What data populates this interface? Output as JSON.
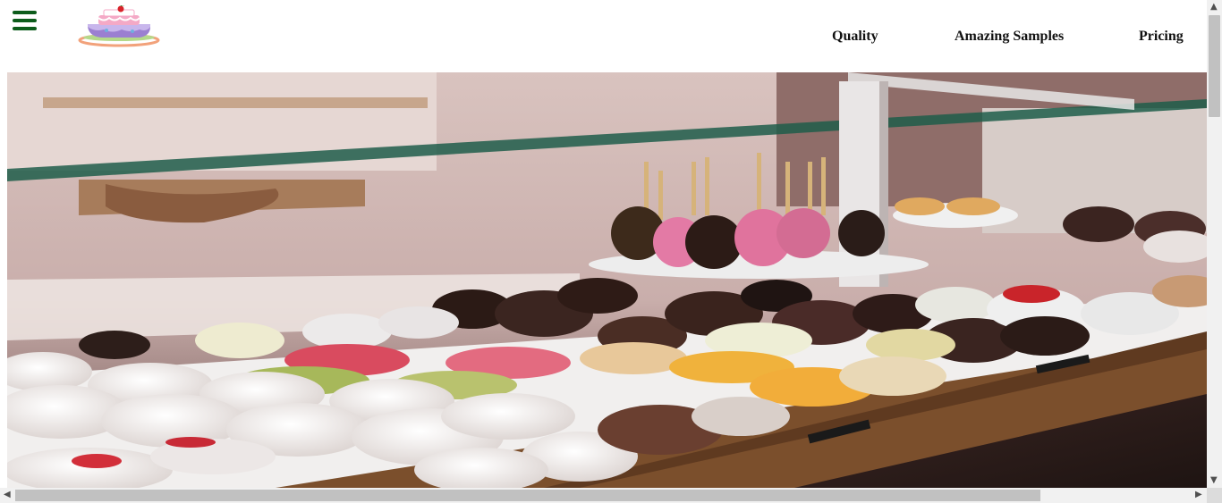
{
  "nav": {
    "menu_icon": "hamburger-menu-icon",
    "logo": "layered-cake-logo",
    "links": [
      "Quality",
      "Amazing Samples",
      "Pricing"
    ]
  },
  "hero": {
    "image": "bakery display case with assorted donuts and cake pops"
  },
  "colors": {
    "menu_icon": "#0d5c1b",
    "nav_text": "#111111",
    "background": "#ffffff"
  }
}
